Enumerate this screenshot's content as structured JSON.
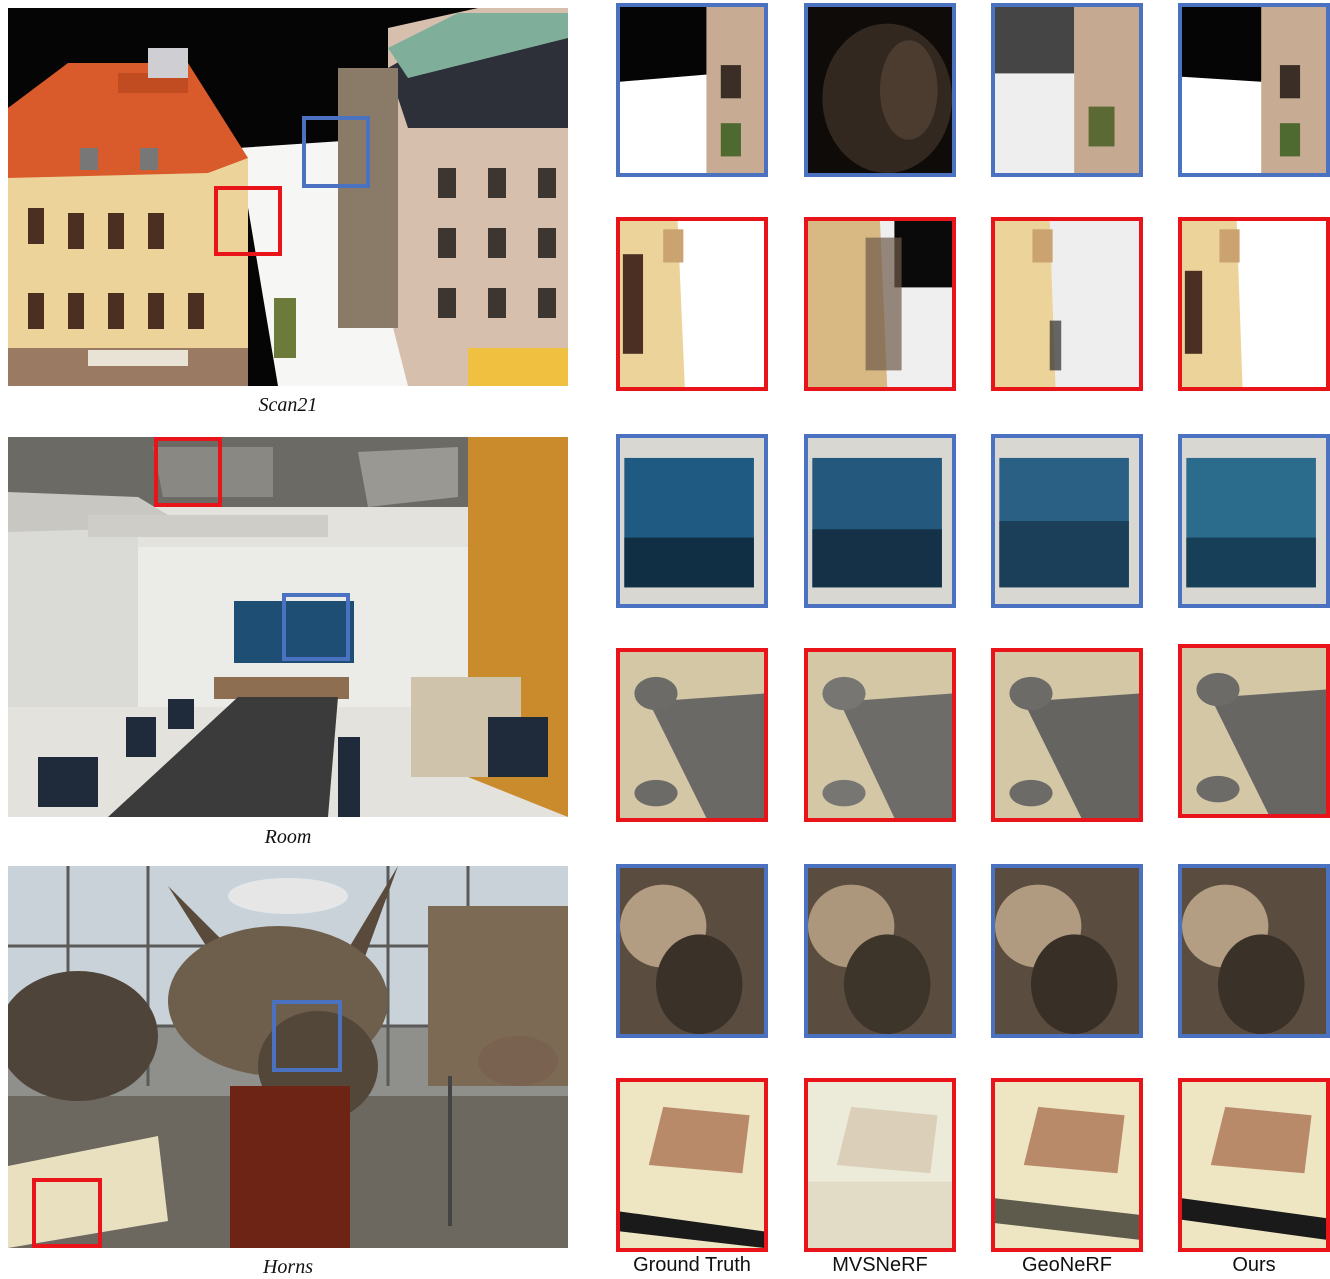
{
  "scenes": [
    {
      "id": "scan21",
      "label": "Scan21"
    },
    {
      "id": "room",
      "label": "Room"
    },
    {
      "id": "horns",
      "label": "Horns"
    }
  ],
  "columns": [
    "Ground Truth",
    "MVSNeRF",
    "GeoNeRF",
    "Ours"
  ],
  "colors": {
    "blue": "#4a72c0",
    "red": "#e8141a"
  }
}
